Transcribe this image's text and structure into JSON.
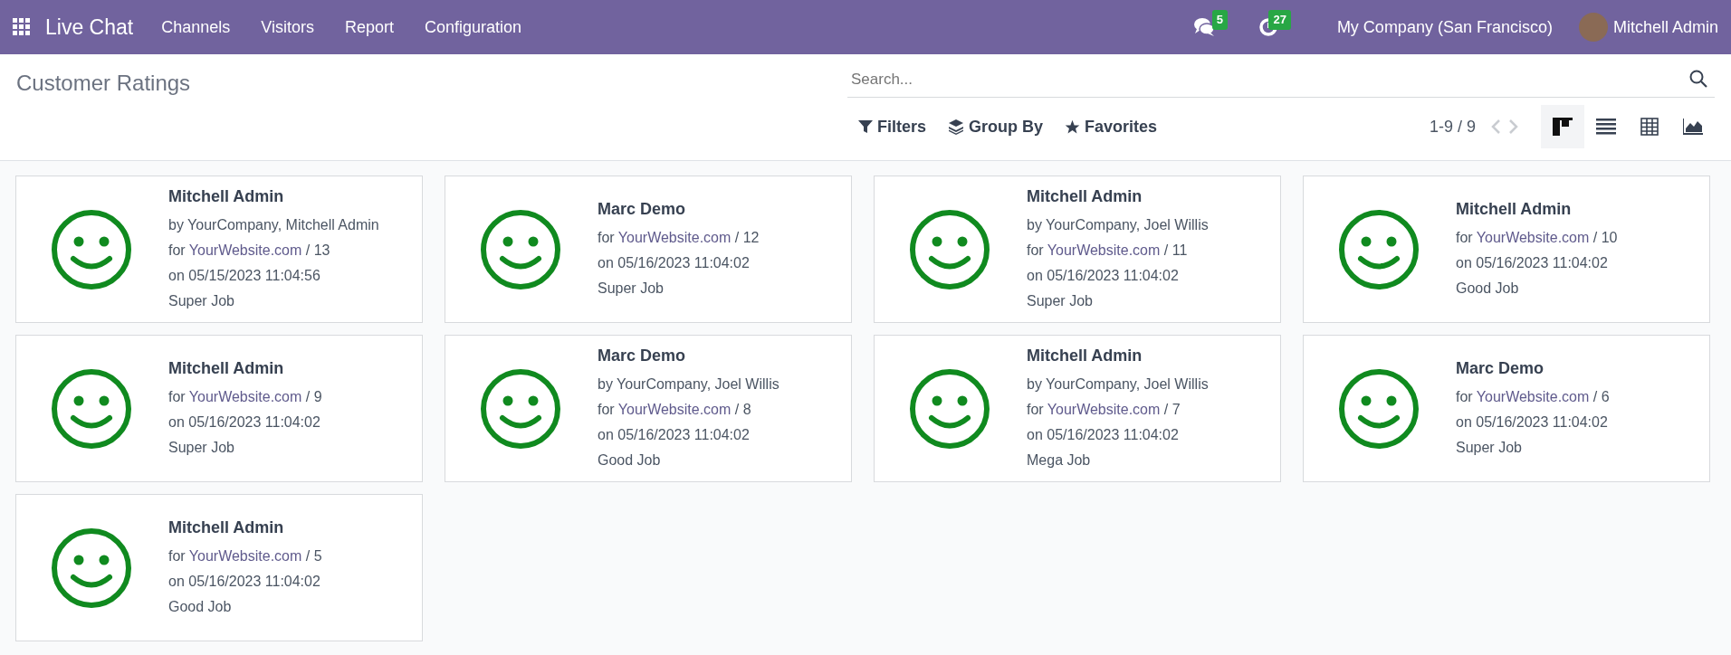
{
  "navbar": {
    "app": "Live Chat",
    "menus": [
      "Channels",
      "Visitors",
      "Report",
      "Configuration"
    ],
    "chat_count": "5",
    "activity_count": "27",
    "company": "My Company (San Francisco)",
    "user": "Mitchell Admin"
  },
  "page_title": "Customer Ratings",
  "search": {
    "placeholder": "Search..."
  },
  "filters": [
    {
      "kind": "filter",
      "label": "Filters"
    },
    {
      "kind": "group",
      "label": "Group By"
    },
    {
      "kind": "favorite",
      "label": "Favorites"
    }
  ],
  "pager": "1-9 / 9",
  "views": [
    {
      "kind": "kanban",
      "selected": true
    },
    {
      "kind": "list",
      "selected": false
    },
    {
      "kind": "pivot",
      "selected": false
    },
    {
      "kind": "graph",
      "selected": false
    }
  ],
  "cards": [
    {
      "name": "Mitchell Admin",
      "by": "by YourCompany, Mitchell Admin",
      "for": "for",
      "channel": "YourWebsite.com",
      "number": "/ 13",
      "date": "on 05/15/2023 11:04:56",
      "rating": "Super Job"
    },
    {
      "name": "Marc Demo",
      "for": "for",
      "channel": "YourWebsite.com",
      "number": "/ 12",
      "date": "on 05/16/2023 11:04:02",
      "rating": "Super Job"
    },
    {
      "name": "Mitchell Admin",
      "by": "by YourCompany, Joel Willis",
      "for": "for",
      "channel": "YourWebsite.com",
      "number": "/ 11",
      "date": "on 05/16/2023 11:04:02",
      "rating": "Super Job"
    },
    {
      "name": "Mitchell Admin",
      "for": "for",
      "channel": "YourWebsite.com",
      "number": "/ 10",
      "date": "on 05/16/2023 11:04:02",
      "rating": "Good Job"
    },
    {
      "name": "Mitchell Admin",
      "for": "for",
      "channel": "YourWebsite.com",
      "number": "/ 9",
      "date": "on 05/16/2023 11:04:02",
      "rating": "Super Job"
    },
    {
      "name": "Marc Demo",
      "by": "by YourCompany, Joel Willis",
      "for": "for",
      "channel": "YourWebsite.com",
      "number": "/ 8",
      "date": "on 05/16/2023 11:04:02",
      "rating": "Good Job"
    },
    {
      "name": "Mitchell Admin",
      "by": "by YourCompany, Joel Willis",
      "for": "for",
      "channel": "YourWebsite.com",
      "number": "/ 7",
      "date": "on 05/16/2023 11:04:02",
      "rating": "Mega Job"
    },
    {
      "name": "Marc Demo",
      "for": "for",
      "channel": "YourWebsite.com",
      "number": "/ 6",
      "date": "on 05/16/2023 11:04:02",
      "rating": "Super Job"
    },
    {
      "name": "Mitchell Admin",
      "for": "for",
      "channel": "YourWebsite.com",
      "number": "/ 5",
      "date": "on 05/16/2023 11:04:02",
      "rating": "Good Job"
    }
  ]
}
